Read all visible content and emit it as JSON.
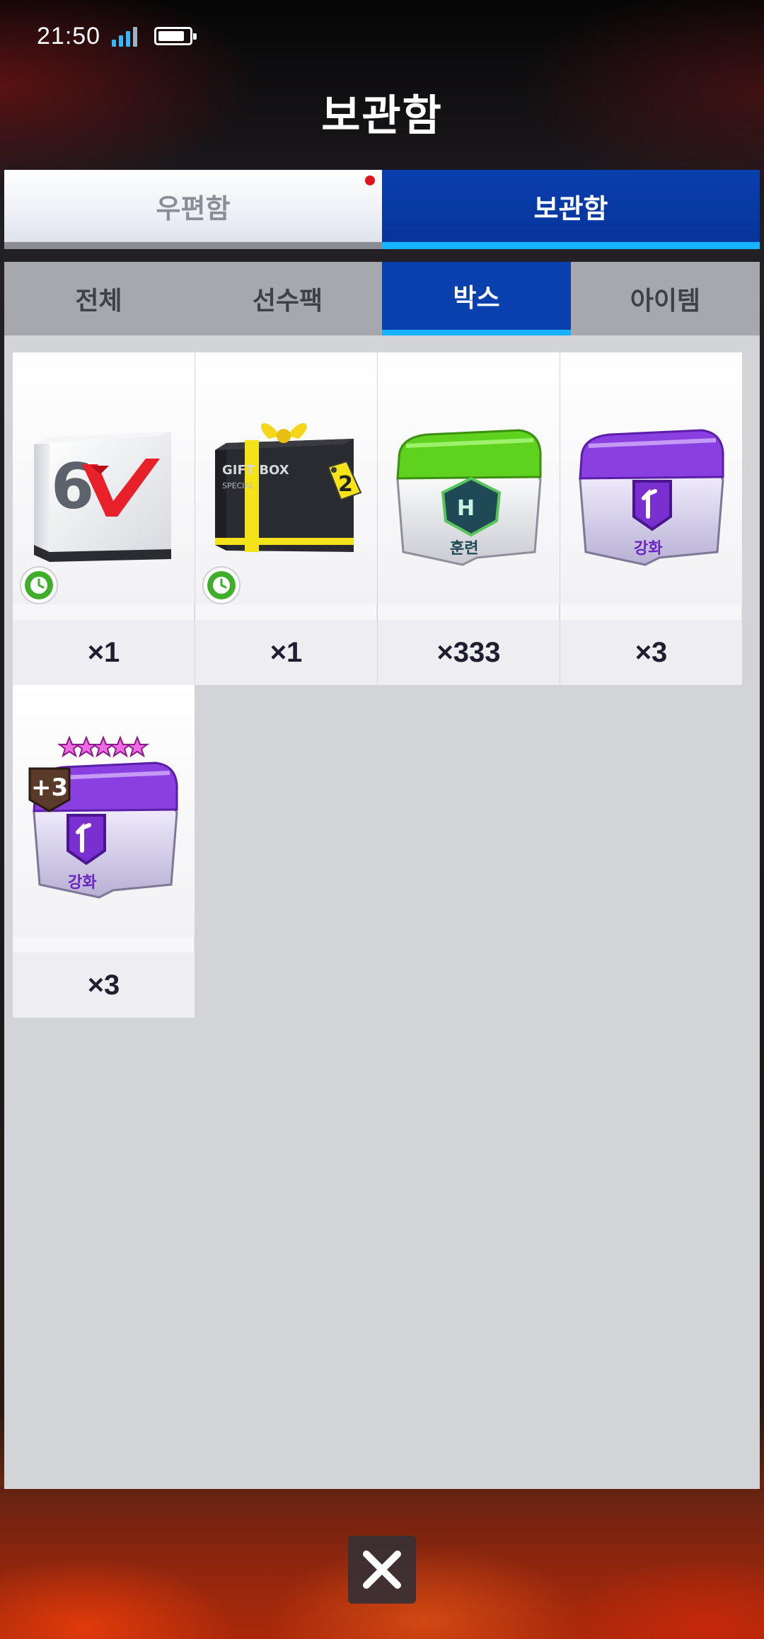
{
  "status_bar": {
    "time": "21:50"
  },
  "header": {
    "title": "보관함"
  },
  "main_tabs": [
    {
      "label": "우편함",
      "active": false,
      "has_notification": true
    },
    {
      "label": "보관함",
      "active": true
    }
  ],
  "sub_tabs": [
    {
      "label": "전체",
      "active": false
    },
    {
      "label": "선수팩",
      "active": false
    },
    {
      "label": "박스",
      "active": true
    },
    {
      "label": "아이템",
      "active": false
    }
  ],
  "items": [
    {
      "icon": "v-cube-box-icon",
      "cube_number": "6",
      "count": "×1",
      "timed": true
    },
    {
      "icon": "gift-box-icon",
      "box_text": "GIFT BOX",
      "box_subtext": "SPECIAL",
      "tag": "2",
      "count": "×1",
      "timed": true
    },
    {
      "icon": "training-chest-icon",
      "label": "훈련",
      "count": "×333",
      "timed": false
    },
    {
      "icon": "enhance-chest-icon",
      "label": "강화",
      "count": "×3",
      "timed": false
    },
    {
      "icon": "enhance-plus3-chest-icon",
      "label": "강화",
      "badge": "+3",
      "stars": 5,
      "count": "×3",
      "timed": false
    }
  ],
  "colors": {
    "active_tab": "#0a3fae",
    "active_underline": "#16b4ff",
    "training_lid": "#5fd11f",
    "enhance_lid": "#8a3fe0",
    "timer_green": "#3fae2a"
  }
}
